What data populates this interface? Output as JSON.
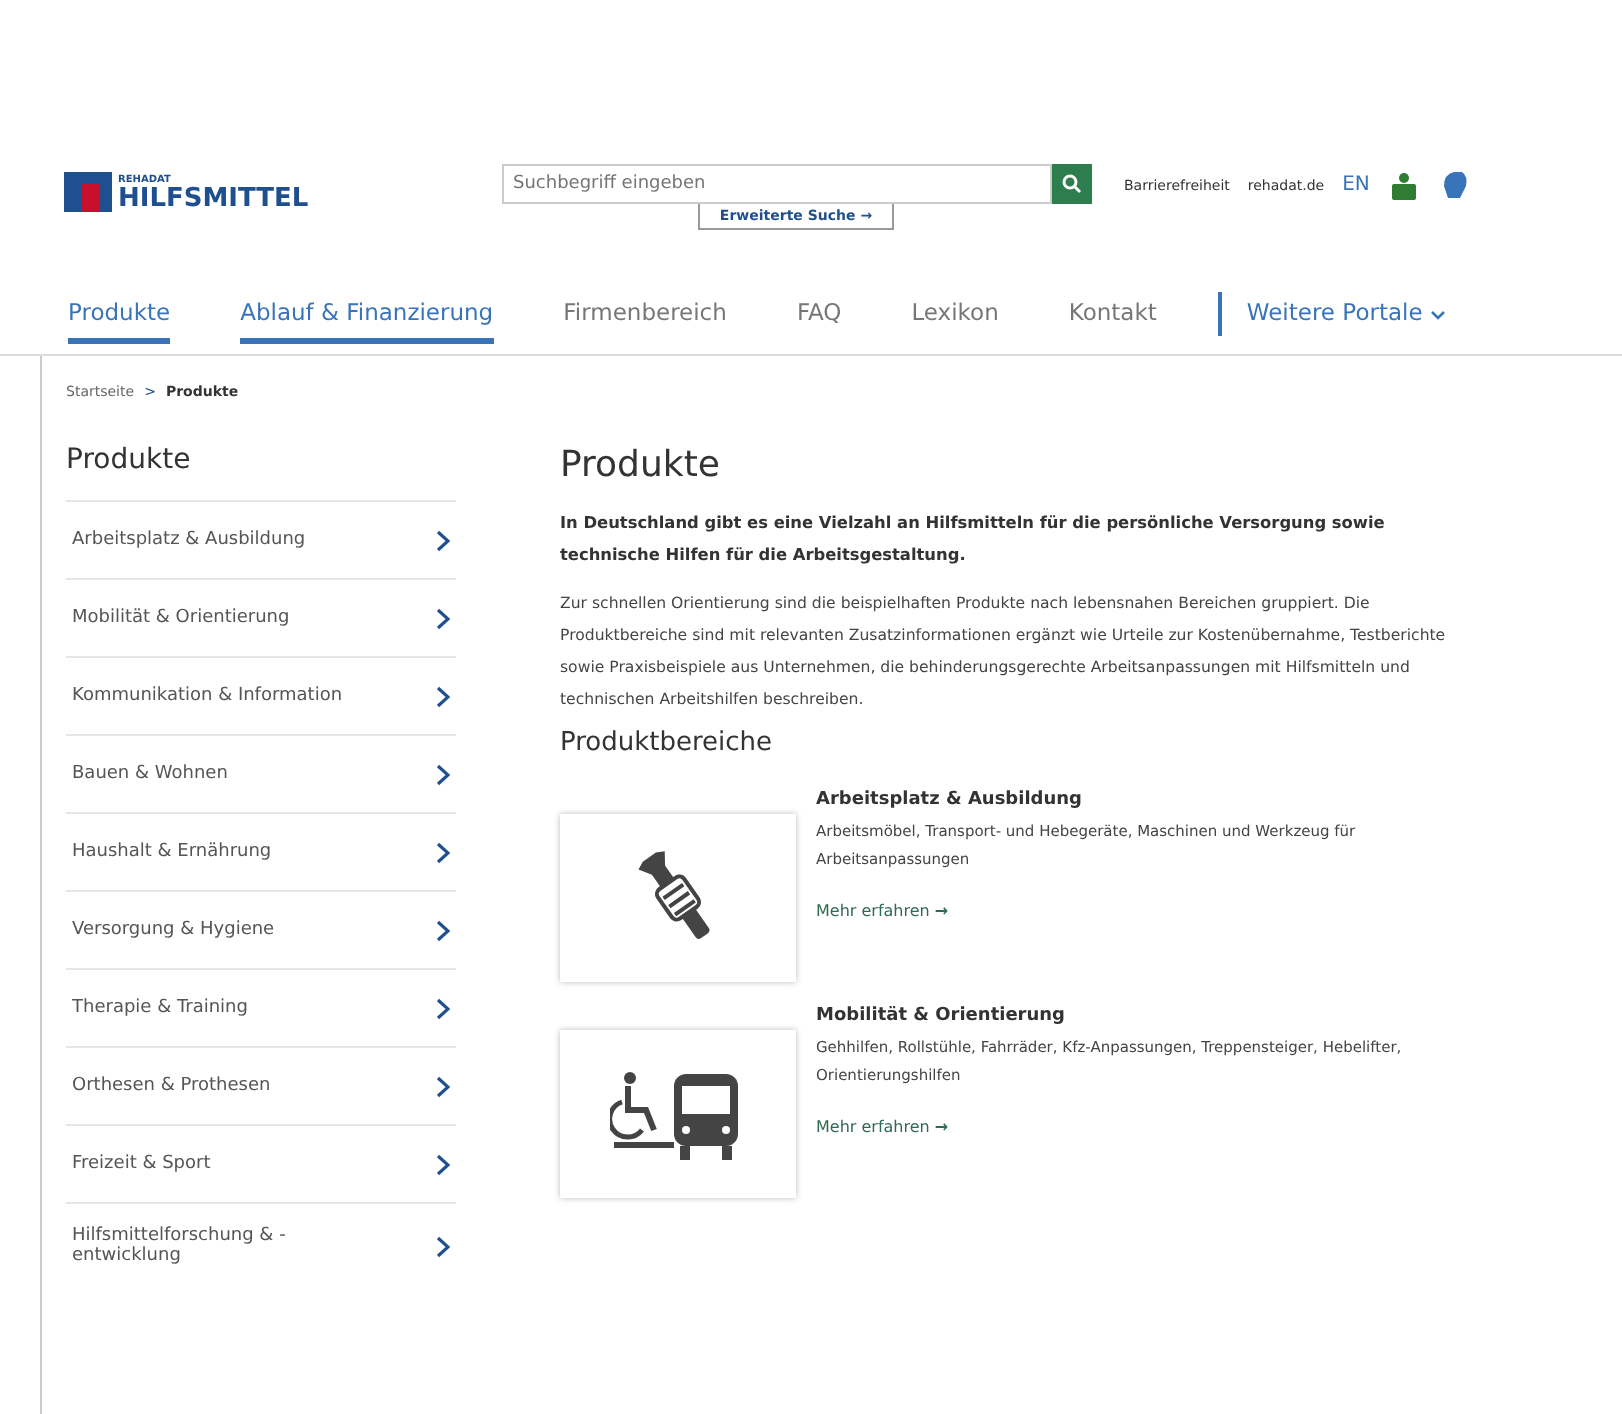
{
  "header": {
    "logo_small": "REHADAT",
    "logo_text": "HILFSMITTEL",
    "search": {
      "placeholder": "Suchbegriff eingeben"
    },
    "advanced_search": "Erweiterte Suche",
    "advanced_arrow": "→",
    "links": [
      "Barrierefreiheit",
      "rehadat.de",
      "EN"
    ]
  },
  "nav": [
    {
      "label": "Produkte",
      "selected": true
    },
    {
      "label": "Ablauf & Finanzierung",
      "selected": true
    },
    {
      "label": "Firmenbereich",
      "selected": false
    },
    {
      "label": "FAQ",
      "selected": false
    },
    {
      "label": "Lexikon",
      "selected": false
    },
    {
      "label": "Kontakt",
      "selected": false
    }
  ],
  "more_portals": "Weitere Portale",
  "breadcrumb": {
    "items": [
      "Startseite",
      "Produkte"
    ],
    "separator": ">"
  },
  "sidebar": {
    "title": "Produkte",
    "items": [
      "Arbeitsplatz & Ausbildung",
      "Mobilität & Orientierung",
      "Kommunikation & Information",
      "Bauen & Wohnen",
      "Haushalt & Ernährung",
      "Versorgung & Hygiene",
      "Therapie & Training",
      "Orthesen & Prothesen",
      "Freizeit & Sport",
      "Hilfsmittelforschung & -entwicklung"
    ]
  },
  "main": {
    "title": "Produkte",
    "lead": "In Deutschland gibt es eine Vielzahl an Hilfsmitteln für die persönliche Versorgung sowie technische Hilfen für die Arbeitsgestaltung.",
    "body": "Zur schnellen Orientierung sind die beispielhaften Produkte nach lebensnahen Bereichen gruppiert. Die Produktbereiche sind mit relevanten Zusatzinformationen ergänzt wie Urteile zur Kostenübernahme, Testberichte sowie Praxisbeispiele aus Unternehmen, die behinderungsgerechte Arbeitsanpassungen mit Hilfsmitteln und technischen Arbeitshilfen beschreiben.",
    "section_title": "Produktbereiche",
    "areas": [
      {
        "kind": "tools",
        "title": "Arbeitsplatz & Ausbildung",
        "text": "Arbeitsmöbel, Transport- und Hebegeräte, Maschinen und Werkzeug für Arbeitsanpassungen",
        "link": "Mehr erfahren",
        "arrow": "→"
      },
      {
        "kind": "mobility",
        "title": "Mobilität & Orientierung",
        "text": "Gehhilfen, Rollstühle, Fahrräder, Kfz-Anpassungen, Treppensteiger, Hebelifter, Orientierungshilfen",
        "link": "Mehr erfahren",
        "arrow": "→"
      }
    ]
  }
}
